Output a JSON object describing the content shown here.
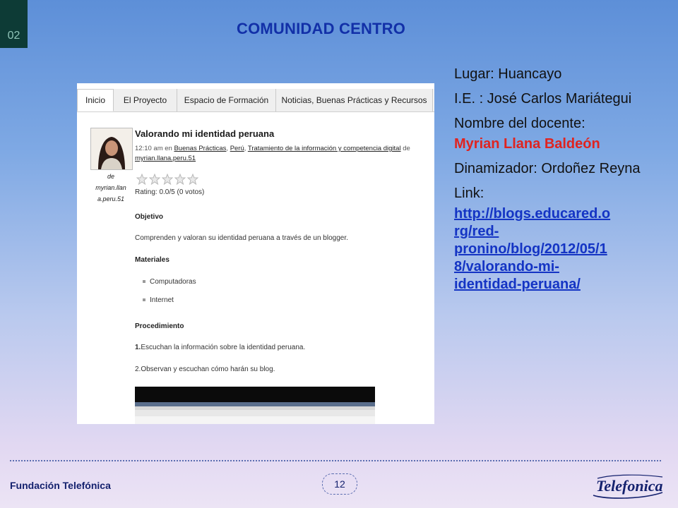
{
  "slide": {
    "number": "02",
    "title": "COMUNIDAD CENTRO",
    "page": "12",
    "footer": "Fundación Telefónica",
    "logo_text": "Telefonica"
  },
  "screenshot": {
    "tabs": [
      "Inicio",
      "El Proyecto",
      "Espacio de Formación",
      "Noticias, Buenas Prácticas y Recursos"
    ],
    "author_caption": [
      "de",
      "myrian.llan",
      "a.peru.51"
    ],
    "post_title": "Valorando mi identidad peruana",
    "meta_line1_prefix": "12:10 am en ",
    "meta_links": [
      "Buenas Prácticas",
      "Perú",
      "Tratamiento de la información y competencia digital"
    ],
    "meta_suffix": " de ",
    "meta_author": "myrian.llana.peru.51",
    "rating_text": "Rating: 0.0/5 (0 votos)",
    "rating_value": 0,
    "rating_max": 5,
    "objetivo_label": "Objetivo",
    "objetivo_text": "Comprenden y valoran su identidad peruana a través de un blogger.",
    "materiales_label": "Materiales",
    "materiales": [
      "Computadoras",
      "Internet"
    ],
    "procedimiento_label": "Procedimiento",
    "step1_num": "1.",
    "step1_text": "Escuchan la información  sobre la identidad peruana.",
    "step2_text": "2.Observan y escuchan  cómo harán su blog."
  },
  "info": {
    "lugar": "Lugar: Huancayo",
    "ie": "I.E. : José Carlos Mariátegui",
    "docente_label": "Nombre del docente:",
    "docente_name": "Myrian Llana Baldeón",
    "dinamizador": "Dinamizador: Ordoñez Reyna",
    "link_label": "Link:",
    "link_url": "http://blogs.educared.org/red-pronino/blog/2012/05/18/valorando-mi-identidad-peruana/",
    "link_display": [
      "http://blogs.educared.o",
      "rg/red-",
      "pronino/blog/2012/05/1",
      "8/valorando-mi-",
      "identidad-peruana/"
    ]
  },
  "colors": {
    "title": "#1230a8",
    "red": "#e0231f",
    "link": "#1434c4"
  },
  "icons": [
    "star-icon",
    "author-avatar",
    "telefonica-logo"
  ]
}
